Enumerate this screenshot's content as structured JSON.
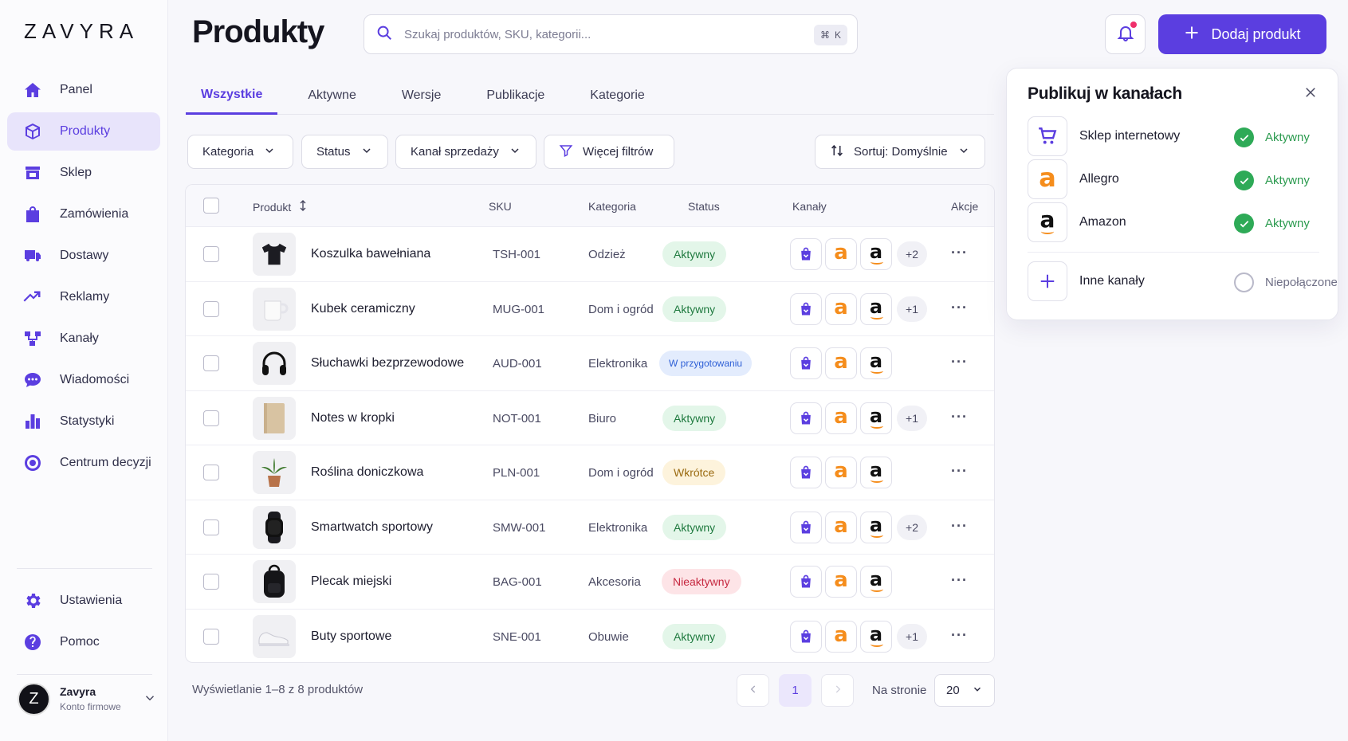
{
  "app": {
    "logo": "ZAVYRA",
    "page_title": "Produkty"
  },
  "sidebar": {
    "items": [
      {
        "label": "Panel",
        "icon": "home-icon",
        "active": false
      },
      {
        "label": "Produkty",
        "icon": "box-icon",
        "active": true
      },
      {
        "label": "Sklep",
        "icon": "store-icon",
        "active": false
      },
      {
        "label": "Zamówienia",
        "icon": "bag-icon",
        "active": false
      },
      {
        "label": "Dostawy",
        "icon": "truck-icon",
        "active": false
      },
      {
        "label": "Reklamy",
        "icon": "trend-icon",
        "active": false
      },
      {
        "label": "Kanały",
        "icon": "channels-icon",
        "active": false
      },
      {
        "label": "Wiadomości",
        "icon": "chat-icon",
        "active": false
      },
      {
        "label": "Statystyki",
        "icon": "bar-chart-icon",
        "active": false
      },
      {
        "label": "Centrum decyzji",
        "icon": "target-icon",
        "active": false
      }
    ],
    "bottom_items": [
      {
        "label": "Ustawienia",
        "icon": "gear-icon"
      },
      {
        "label": "Pomoc",
        "icon": "help-icon"
      }
    ],
    "account": {
      "initial": "Z",
      "name": "Zavyra",
      "subtitle": "Konto firmowe"
    }
  },
  "search": {
    "placeholder": "Szukaj produktów, SKU, kategorii...",
    "shortcut_symbol": "⌘",
    "shortcut_key": "K"
  },
  "add_button": {
    "label": "Dodaj produkt"
  },
  "tabs": [
    {
      "label": "Wszystkie",
      "active": true
    },
    {
      "label": "Aktywne",
      "active": false
    },
    {
      "label": "Wersje",
      "active": false
    },
    {
      "label": "Publikacje",
      "active": false
    },
    {
      "label": "Kategorie",
      "active": false
    }
  ],
  "filters": {
    "category": "Kategoria",
    "status": "Status",
    "channel": "Kanał sprzedaży",
    "more": "Więcej filtrów",
    "sort": "Sortuj: Domyślnie"
  },
  "table": {
    "headers": {
      "product": "Produkt",
      "sku": "SKU",
      "category": "Kategoria",
      "status": "Status",
      "channels": "Kanały",
      "actions": "Akcje"
    },
    "rows": [
      {
        "name": "Koszulka bawełniana",
        "sku": "TSH-001",
        "category": "Odzież",
        "status": "Aktywny",
        "status_type": "green",
        "extra": "+2",
        "thumb": "tshirt"
      },
      {
        "name": "Kubek ceramiczny",
        "sku": "MUG-001",
        "category": "Dom i ogród",
        "status": "Aktywny",
        "status_type": "green",
        "extra": "+1",
        "thumb": "mug"
      },
      {
        "name": "Słuchawki bezprzewodowe",
        "sku": "AUD-001",
        "category": "Elektronika",
        "status": "W przygotowaniu",
        "status_type": "blue",
        "extra": "",
        "thumb": "headphones"
      },
      {
        "name": "Notes w kropki",
        "sku": "NOT-001",
        "category": "Biuro",
        "status": "Aktywny",
        "status_type": "green",
        "extra": "+1",
        "thumb": "notebook"
      },
      {
        "name": "Roślina doniczkowa",
        "sku": "PLN-001",
        "category": "Dom i ogród",
        "status": "Wkrótce",
        "status_type": "yellow",
        "extra": "",
        "thumb": "plant"
      },
      {
        "name": "Smartwatch sportowy",
        "sku": "SMW-001",
        "category": "Elektronika",
        "status": "Aktywny",
        "status_type": "green",
        "extra": "+2",
        "thumb": "watch"
      },
      {
        "name": "Plecak miejski",
        "sku": "BAG-001",
        "category": "Akcesoria",
        "status": "Nieaktywny",
        "status_type": "red",
        "extra": "",
        "thumb": "backpack"
      },
      {
        "name": "Buty sportowe",
        "sku": "SNE-001",
        "category": "Obuwie",
        "status": "Aktywny",
        "status_type": "green",
        "extra": "+1",
        "thumb": "sneaker"
      }
    ]
  },
  "footer": {
    "info": "Wyświetlanie 1–8 z 8 produktów",
    "page": "1",
    "per_page_label": "Na stronie",
    "per_page": "20"
  },
  "panel": {
    "title": "Publikuj w kanałach",
    "channels": [
      {
        "name": "Sklep internetowy",
        "status": "Aktywny",
        "connected": true,
        "icon": "cart-icon"
      },
      {
        "name": "Allegro",
        "status": "Aktywny",
        "connected": true,
        "icon": "allegro-icon"
      },
      {
        "name": "Amazon",
        "status": "Aktywny",
        "connected": true,
        "icon": "amazon-icon"
      }
    ],
    "other": {
      "name": "Inne kanały",
      "status": "Niepołączone"
    }
  },
  "colors": {
    "accent": "#5b3ee0",
    "active_green": "#2eaa57",
    "allegro_orange": "#f58d1c"
  }
}
